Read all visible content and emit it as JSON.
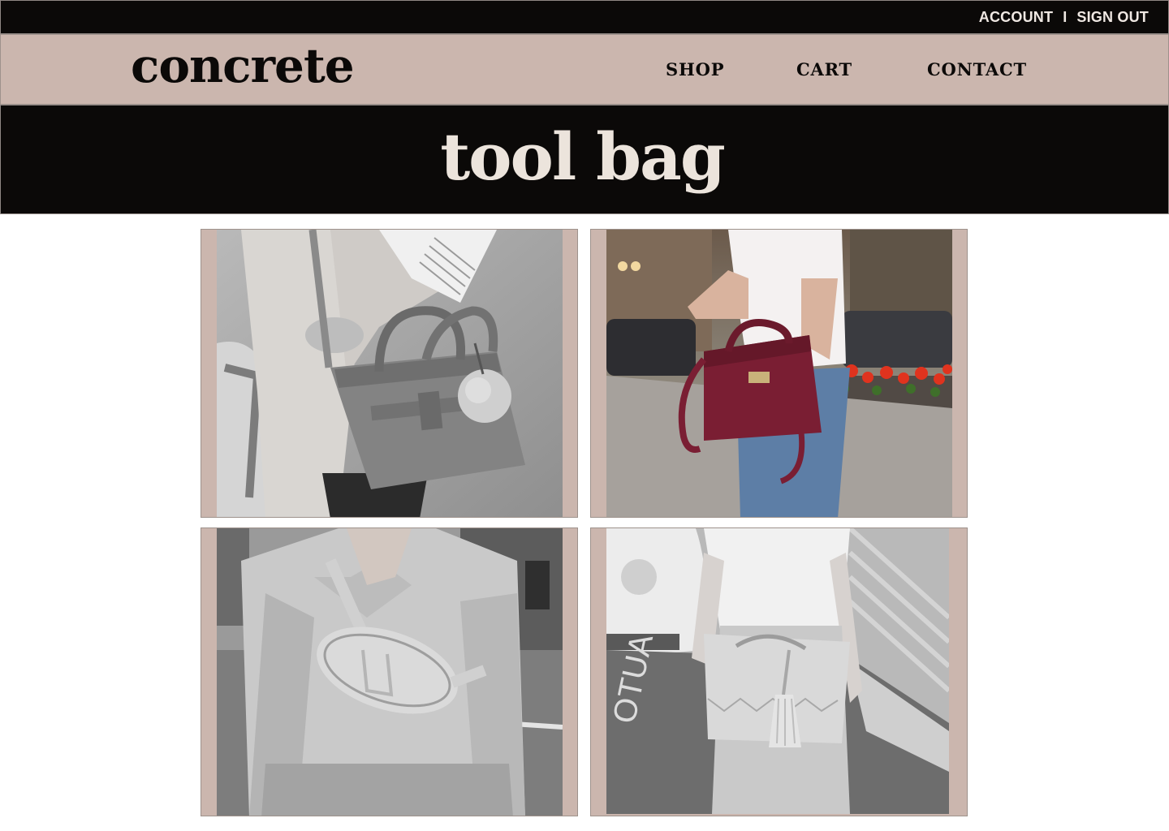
{
  "topbar": {
    "account_label": "ACCOUNT",
    "separator": "I",
    "signout_label": "SIGN OUT"
  },
  "header": {
    "logo": "concrete",
    "nav": {
      "shop": "SHOP",
      "cart": "CART",
      "contact": "CONTACT"
    }
  },
  "hero": {
    "title": "tool bag"
  },
  "colors": {
    "dark": "#0b0908",
    "accent": "#cbb6ae",
    "hero_text": "#ece4dc",
    "bag_red": "#7a1e33"
  },
  "gallery": {
    "items": [
      {
        "photo": "grayscale-handbag-with-pompom"
      },
      {
        "photo": "burgundy-leather-bag-street"
      },
      {
        "photo": "grayscale-belt-bag"
      },
      {
        "photo": "grayscale-bucket-bag-with-tassel"
      }
    ]
  }
}
